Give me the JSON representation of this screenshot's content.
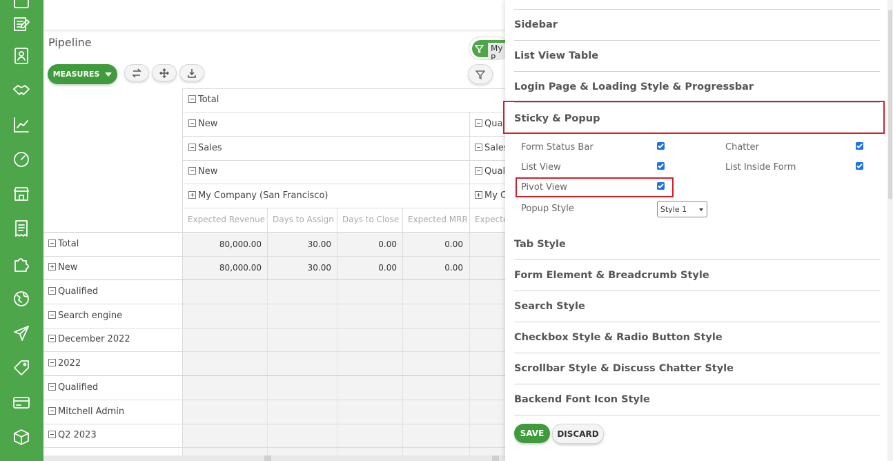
{
  "rail": {
    "icons": [
      "notes-icon",
      "contacts-icon",
      "handshake-icon",
      "chart-line-icon",
      "dashboard-gauge-icon",
      "store-icon",
      "receipt-icon",
      "puzzle-icon",
      "globe-icon",
      "send-icon",
      "tag-icon",
      "card-icon",
      "box-icon"
    ]
  },
  "page": {
    "title": "Pipeline"
  },
  "toolbar": {
    "measures_label": "MEASURES",
    "filter_pill_label": "My P"
  },
  "pivot": {
    "col_headers": {
      "total": "Total",
      "level1_left": "New",
      "level1_right": "Qua",
      "level2_left": "Sales",
      "level2_right": "Sales",
      "level3_left": "New",
      "level3_right": "Quali",
      "level4_left": "My Company (San Francisco)",
      "level4_right": "My C"
    },
    "measures": [
      "Expected Revenue",
      "Days to Assign",
      "Days to Close",
      "Expected MRR",
      "Expecte"
    ],
    "rows": [
      {
        "label": "Total",
        "values": [
          "80,000.00",
          "30.00",
          "0.00",
          "0.00"
        ]
      },
      {
        "label": "New",
        "values": [
          "80,000.00",
          "30.00",
          "0.00",
          "0.00"
        ]
      },
      {
        "label": "Qualified",
        "values": []
      },
      {
        "label": "Search engine",
        "values": []
      },
      {
        "label": "December 2022",
        "values": []
      },
      {
        "label": "2022",
        "values": []
      },
      {
        "label": "Qualified",
        "values": []
      },
      {
        "label": "Mitchell Admin",
        "values": []
      },
      {
        "label": "Q2 2023",
        "values": []
      }
    ]
  },
  "settings": {
    "sections_top": [
      "Sidebar",
      "List View Table",
      "Login Page & Loading Style & Progressbar",
      "Sticky & Popup"
    ],
    "options": {
      "form_status_bar": "Form Status Bar",
      "chatter": "Chatter",
      "list_view": "List View",
      "list_inside_form": "List Inside Form",
      "pivot_view": "Pivot View",
      "popup_style": "Popup Style",
      "popup_style_value": "Style 1"
    },
    "sections_bottom": [
      "Tab Style",
      "Form Element & Breadcrumb Style",
      "Search Style",
      "Checkbox Style & Radio Button Style",
      "Scrollbar Style & Discuss Chatter Style",
      "Backend Font Icon Style"
    ],
    "save_label": "SAVE",
    "discard_label": "DISCARD"
  },
  "colors": {
    "accent": "#4ea64a",
    "highlight": "#d0212b",
    "checkbox": "#1a73e8"
  }
}
